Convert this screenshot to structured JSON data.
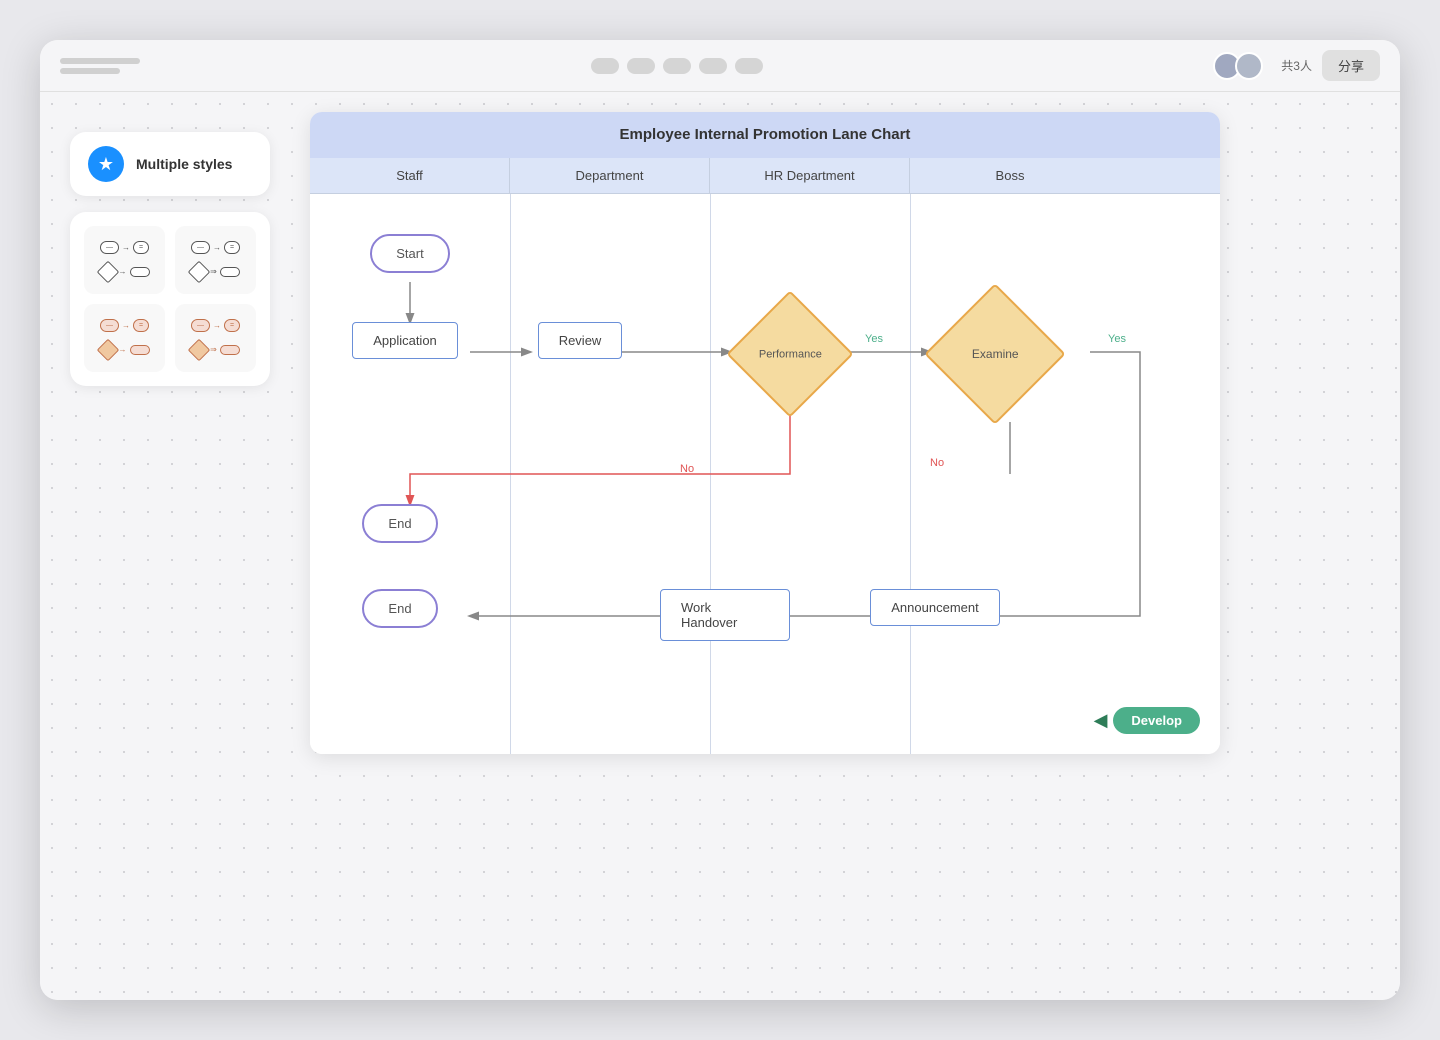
{
  "window": {
    "title": "Employee Internal Promotion Lane Chart",
    "user_count": "共3人",
    "share_label": "分享"
  },
  "toolbar": {
    "dots": [
      "dot1",
      "dot2",
      "dot3",
      "dot4",
      "dot5"
    ]
  },
  "left_panel": {
    "style_button_label": "Multiple styles",
    "star_icon": "★",
    "styles": [
      {
        "id": "style-1",
        "type": "outline"
      },
      {
        "id": "style-2",
        "type": "outline-arrow"
      },
      {
        "id": "style-3",
        "type": "orange-filled"
      },
      {
        "id": "style-4",
        "type": "orange-filled-arrow"
      }
    ]
  },
  "diagram": {
    "title": "Employee Internal Promotion Lane Chart",
    "lanes": [
      "Staff",
      "Department",
      "HR Department",
      "Boss"
    ],
    "nodes": {
      "start": "Start",
      "application": "Application",
      "review": "Review",
      "performance": "Performance",
      "examine": "Examine",
      "end1": "End",
      "end2": "End",
      "work_handover": "Work Handover",
      "announcement": "Announcement"
    },
    "arrow_labels": {
      "yes1": "Yes",
      "no1": "No",
      "no2": "No",
      "yes2": "Yes"
    },
    "develop_label": "Develop"
  }
}
